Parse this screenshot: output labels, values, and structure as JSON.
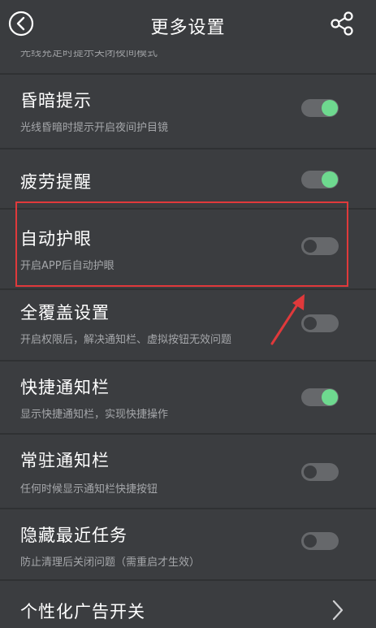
{
  "header": {
    "title": "更多设置",
    "back_icon": "back-circle-icon",
    "share_icon": "share-icon"
  },
  "partial": {
    "subtitle": "光线充足时提示关闭夜间模式"
  },
  "settings": [
    {
      "label": "昏暗提示",
      "subtitle": "光线昏暗时提示开启夜间护目镜",
      "enabled": true
    },
    {
      "label": "疲劳提醒",
      "subtitle": "",
      "enabled": true
    },
    {
      "label": "自动护眼",
      "subtitle": "开启APP后自动护眼",
      "enabled": false
    },
    {
      "label": "全覆盖设置",
      "subtitle": "开启权限后，解决通知栏、虚拟按钮无效问题",
      "enabled": false
    },
    {
      "label": "快捷通知栏",
      "subtitle": "显示快捷通知栏，实现快捷操作",
      "enabled": true
    },
    {
      "label": "常驻通知栏",
      "subtitle": "任何时候显示通知栏快捷按钮",
      "enabled": false
    },
    {
      "label": "隐藏最近任务",
      "subtitle": "防止清理后关闭问题（需重启才生效）",
      "enabled": false
    },
    {
      "label": "个性化广告开关",
      "subtitle": ""
    }
  ],
  "colors": {
    "accent_on": "#6ed98f",
    "background": "#3b3d40",
    "highlight": "#e0393b"
  }
}
